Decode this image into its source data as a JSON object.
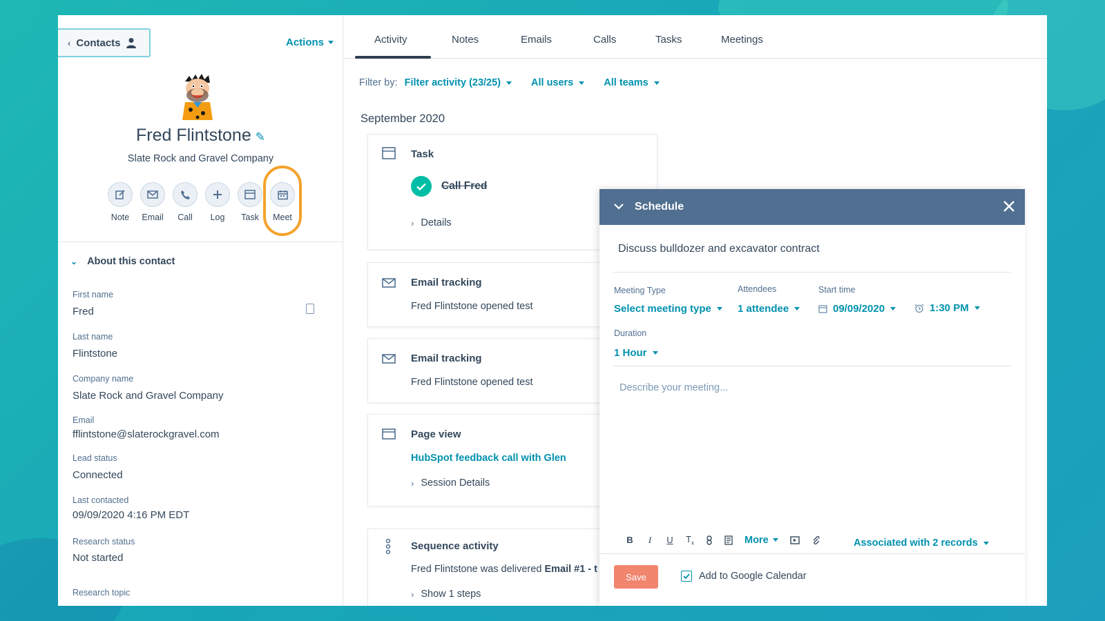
{
  "header": {
    "contacts_label": "Contacts",
    "actions_label": "Actions"
  },
  "contact": {
    "name": "Fred Flintstone",
    "company": "Slate Rock and Gravel Company"
  },
  "quick_actions": [
    {
      "label": "Note",
      "icon": "note-icon"
    },
    {
      "label": "Email",
      "icon": "email-icon"
    },
    {
      "label": "Call",
      "icon": "call-icon"
    },
    {
      "label": "Log",
      "icon": "plus-icon"
    },
    {
      "label": "Task",
      "icon": "task-icon"
    },
    {
      "label": "Meet",
      "icon": "calendar-icon"
    }
  ],
  "about": {
    "title": "About this contact",
    "properties": [
      {
        "label": "First name",
        "value": "Fred"
      },
      {
        "label": "Last name",
        "value": "Flintstone"
      },
      {
        "label": "Company name",
        "value": "Slate Rock and Gravel Company"
      },
      {
        "label": "Email",
        "value": "fflintstone@slaterockgravel.com"
      },
      {
        "label": "Lead status",
        "value": "Connected"
      },
      {
        "label": "Last contacted",
        "value": "09/09/2020 4:16 PM EDT"
      },
      {
        "label": "Research status",
        "value": "Not started"
      },
      {
        "label": "Research topic",
        "value": ""
      }
    ]
  },
  "tabs": [
    "Activity",
    "Notes",
    "Emails",
    "Calls",
    "Tasks",
    "Meetings"
  ],
  "filter": {
    "label": "Filter by:",
    "activity": "Filter activity (23/25)",
    "users": "All users",
    "teams": "All teams"
  },
  "month": "September 2020",
  "activities": {
    "task": {
      "type": "Task",
      "title": "Call Fred",
      "details": "Details"
    },
    "email1": {
      "type": "Email tracking",
      "text": "Fred Flintstone opened test"
    },
    "email2": {
      "type": "Email tracking",
      "text": "Fred Flintstone opened test"
    },
    "pageview": {
      "type": "Page view",
      "link": "HubSpot feedback call with Glen",
      "details": "Session Details"
    },
    "sequence": {
      "type": "Sequence activity",
      "text_prefix": "Fred Flintstone was delivered",
      "text_bold": "Email #1 - t",
      "steps": "Show 1 steps"
    }
  },
  "schedule": {
    "header": "Schedule",
    "title": "Discuss bulldozer and excavator contract",
    "meeting_type_label": "Meeting Type",
    "meeting_type_value": "Select meeting type",
    "attendees_label": "Attendees",
    "attendees_value": "1 attendee",
    "start_time_label": "Start time",
    "start_date": "09/09/2020",
    "start_time": "1:30 PM",
    "duration_label": "Duration",
    "duration_value": "1 Hour",
    "description_placeholder": "Describe your meeting...",
    "toolbar_more": "More",
    "associated": "Associated with 2 records",
    "save_label": "Save",
    "google_calendar": "Add to Google Calendar",
    "google_calendar_checked": true
  },
  "colors": {
    "accent": "#0091ae",
    "highlight_ring": "#f4a22c",
    "save": "#f2856e",
    "modal_header": "#516f90",
    "success": "#00bda5"
  }
}
